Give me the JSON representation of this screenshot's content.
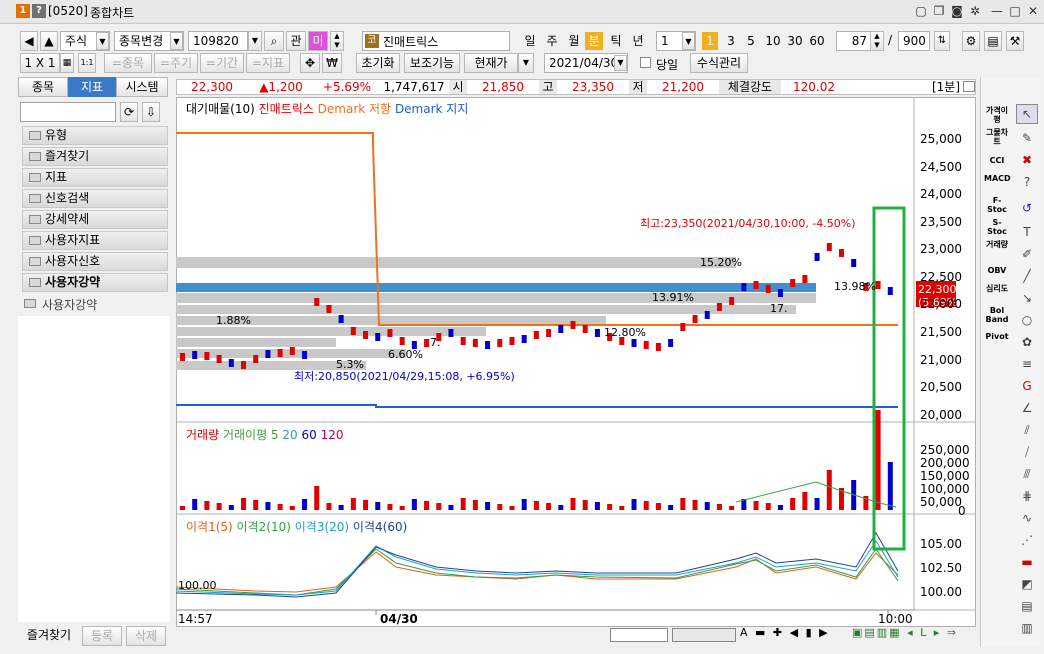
{
  "title": {
    "num1": "1",
    "num2": "?",
    "code": "[0520]",
    "name": "종합차트"
  },
  "toolbar": {
    "market": "주식",
    "change": "종목변경",
    "code": "109820",
    "gwan": "관",
    "mi": "미",
    "corp_badge": "코",
    "stock": "진매트릭스",
    "day": "일",
    "week": "주",
    "month": "월",
    "min": "분",
    "tick": "틱",
    "year": "년",
    "period_val": "1",
    "p1": "1",
    "p3": "3",
    "p5": "5",
    "p10": "10",
    "p30": "30",
    "p60": "60",
    "count": "87",
    "total": "900"
  },
  "toolbar2": {
    "layout": "1 X 1",
    "opt1": "=종목",
    "opt2": "=주기",
    "opt3": "=기간",
    "opt4": "=지표",
    "reset": "초기화",
    "assist": "보조기능",
    "current": "현재가",
    "date": "2021/04/30",
    "today_label": "당일",
    "formula": "수식관리"
  },
  "price_bar": {
    "price": "22,300",
    "change": "▲1,200",
    "pct": "+5.69%",
    "volume": "1,747,617",
    "open_l": "시",
    "open": "21,850",
    "high_l": "고",
    "high": "23,350",
    "low_l": "저",
    "low": "21,200",
    "strength_l": "체결강도",
    "strength": "120.02",
    "interval": "[1분]"
  },
  "left_panel": {
    "tabs": [
      "종목",
      "지표",
      "시스템"
    ],
    "items": [
      "유형",
      "즐겨찾기",
      "지표",
      "신호검색",
      "강세약세",
      "사용자지표",
      "사용자신호",
      "사용자강약"
    ],
    "sub": "사용자강약",
    "bottom": [
      "즐겨찾기",
      "등록",
      "삭제"
    ]
  },
  "legend1": {
    "a": "대기매물(10)",
    "b": "진매트릭스",
    "c": "Demark 저항",
    "d": "Demark 지지"
  },
  "legend2": {
    "a": "거래량",
    "b": "거래이평 5",
    "c": "20",
    "d": "60",
    "e": "120"
  },
  "legend3": {
    "a": "이격1(5)",
    "b": "이격2(10)",
    "c": "이격3(20)",
    "d": "이격4(60)"
  },
  "annotations": {
    "high": "최고:23,350(2021/04/30,10:00, -4.50%)",
    "low": "최저:20,850(2021/04/29,15:08, +6.95%)",
    "p1": "15.20%",
    "p2": "13.91%",
    "p3": "1.88%",
    "p4": "6.60%",
    "p5": "12.80%",
    "p6": "17.",
    "p7": "7.",
    "p8": "13.98%",
    "p9": "5.3%",
    "cur_price": "22,300",
    "cur_pct": "(5.69%)",
    "vol_base": "100.00"
  },
  "price_axis": [
    "25,000",
    "24,500",
    "24,000",
    "23,500",
    "23,000",
    "22,500",
    "22,000",
    "21,500",
    "21,000",
    "20,500",
    "20,000"
  ],
  "vol_axis": [
    "250,000",
    "200,000",
    "150,000",
    "100,000",
    "50,000",
    "0"
  ],
  "osc_axis": [
    "105.00",
    "102.50",
    "100.00"
  ],
  "time_axis": {
    "t1": "14:57",
    "t2": "04/30",
    "t3": "10:00"
  },
  "right_tools": [
    "가격이평",
    "그물차트",
    "CCI",
    "MACD",
    "F-Stoc",
    "S-Stoc",
    "거래량",
    "OBV",
    "심리도",
    "Bol Band",
    "Pivot"
  ],
  "colors": {
    "up": "#e00000",
    "down": "#0000cc",
    "orange": "#f07020",
    "blue": "#2060d0",
    "highlight": "#20b040"
  }
}
